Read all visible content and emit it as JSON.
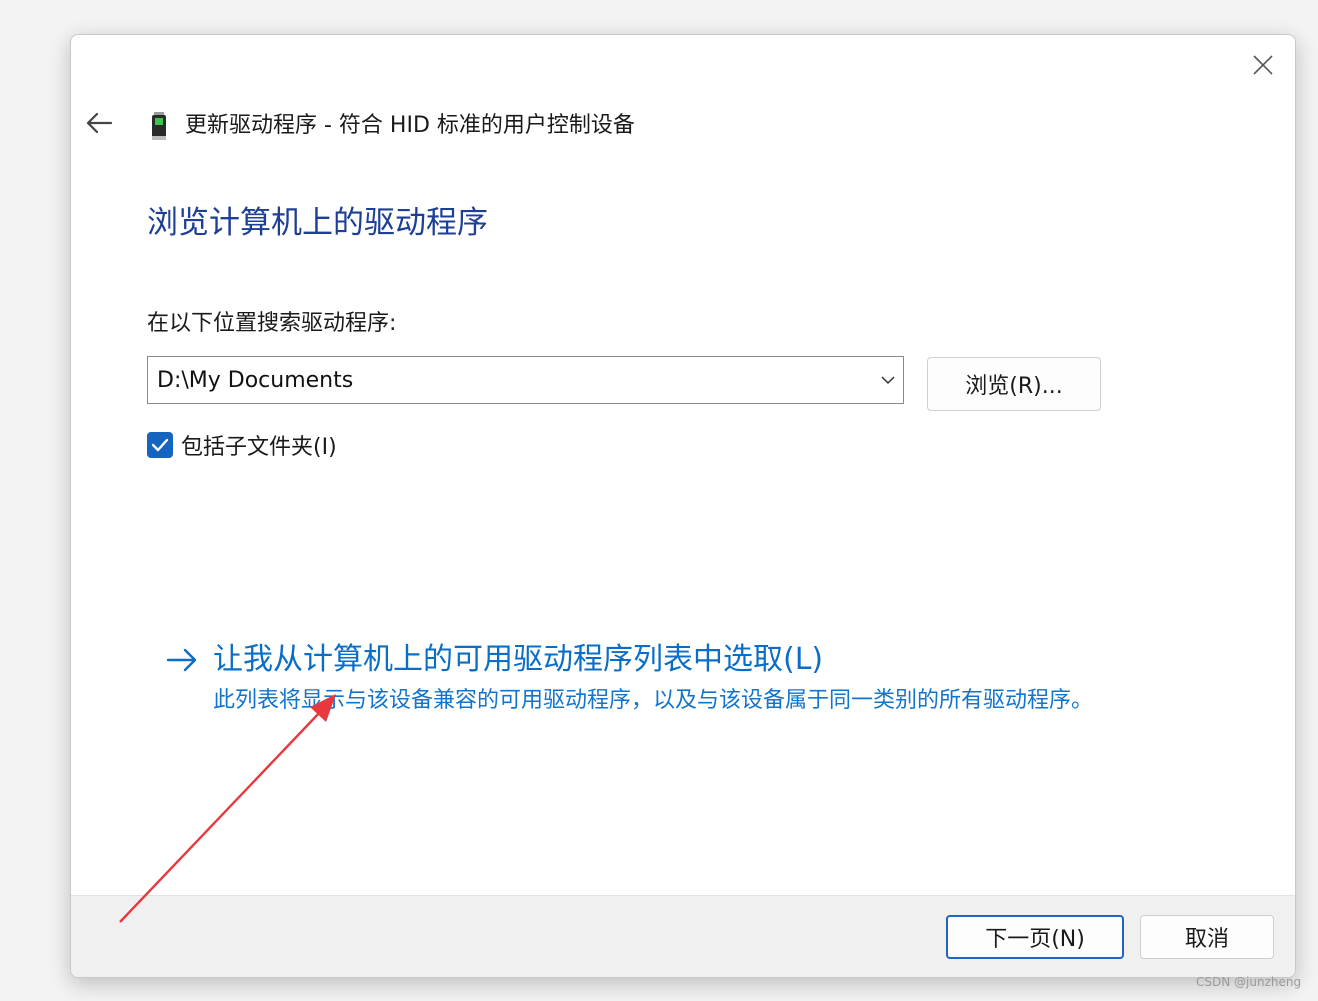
{
  "window": {
    "title": "更新驱动程序 - 符合 HID 标准的用户控制设备",
    "close_icon": "close-icon",
    "back_icon": "arrow-left-icon",
    "device_icon": "usb-device-icon"
  },
  "main": {
    "heading": "浏览计算机上的驱动程序",
    "search_label": "在以下位置搜索驱动程序:",
    "path_value": "D:\\My Documents",
    "browse_label": "浏览(R)...",
    "include_subfolders": {
      "label": "包括子文件夹(I)",
      "checked": true
    },
    "pick_from_list": {
      "title": "让我从计算机上的可用驱动程序列表中选取(L)",
      "description": "此列表将显示与该设备兼容的可用驱动程序，以及与该设备属于同一类别的所有驱动程序。"
    }
  },
  "footer": {
    "next_label": "下一页(N)",
    "cancel_label": "取消"
  },
  "watermark": "CSDN @junzheng",
  "colors": {
    "heading": "#1e3f96",
    "link": "#0a6ec7",
    "checkbox": "#1565c0",
    "annotation": "#e8383d"
  }
}
